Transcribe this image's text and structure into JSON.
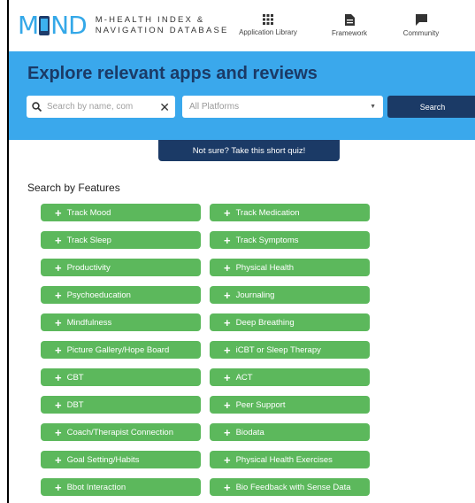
{
  "header": {
    "logo_text": "MND",
    "logo_sub_line1": "M-HEALTH INDEX &",
    "logo_sub_line2": "NAVIGATION DATABASE",
    "nav": [
      {
        "label": "Application Library",
        "icon": "grid-icon"
      },
      {
        "label": "Framework",
        "icon": "document-icon"
      },
      {
        "label": "Community",
        "icon": "chat-icon"
      }
    ]
  },
  "hero": {
    "title": "Explore relevant apps and reviews",
    "search_placeholder": "Search by name, com",
    "platform_selected": "All Platforms",
    "search_button": "Search"
  },
  "quiz_button": "Not sure? Take this short quiz!",
  "features": {
    "title": "Search by Features",
    "left": [
      "Track Mood",
      "Track Sleep",
      "Productivity",
      "Psychoeducation",
      "Mindfulness",
      "Picture Gallery/Hope Board",
      "CBT",
      "DBT",
      "Coach/Therapist Connection",
      "Goal Setting/Habits",
      "Bbot Interaction"
    ],
    "right": [
      "Track Medication",
      "Track Symptoms",
      "Physical Health",
      "Journaling",
      "Deep Breathing",
      "iCBT or Sleep Therapy",
      "ACT",
      "Peer Support",
      "Biodata",
      "Physical Health Exercises",
      "Bio Feedback with Sense Data"
    ]
  },
  "colors": {
    "band": "#3aa8ec",
    "navy": "#1b3a66",
    "feature_green": "#5cb85c",
    "logo_blue": "#34a8e8"
  }
}
